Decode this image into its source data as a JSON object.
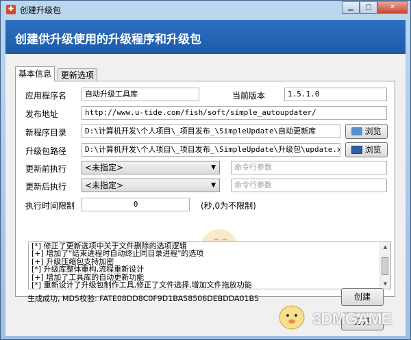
{
  "window": {
    "title": "创建升级包",
    "controls": [
      "▁",
      "▢",
      "✕"
    ]
  },
  "header": {
    "title": "创建供升级使用的升级程序和升级包"
  },
  "tabs": [
    {
      "label": "基本信息"
    },
    {
      "label": "更新选项"
    }
  ],
  "form": {
    "app_name_label": "应用程序名",
    "app_name_value": "自动升级工具库",
    "version_label": "当前版本",
    "version_value": "1.5.1.0",
    "publish_url_label": "发布地址",
    "publish_url_value": "http://www.u-tide.com/fish/soft/simple_autoupdater/",
    "new_dir_label": "新程序目录",
    "new_dir_value": "D:\\计算机开发\\个人项目\\_项目发布_\\SimpleUpdate\\自动更新库",
    "browse_label": "浏览",
    "package_path_label": "升级包路径",
    "package_path_value": "D:\\计算机开发\\个人项目\\_项目发布_\\SimpleUpdate\\升级包\\update.x",
    "browse2_label": "浏览",
    "pre_exec_label": "更新前执行",
    "pre_exec_select": "<未指定>",
    "pre_exec_args_placeholder": "命令行参数",
    "post_exec_label": "更新后执行",
    "post_exec_select": "<未指定>",
    "post_exec_args_placeholder": "命令行参数",
    "timeout_label": "执行时间限制",
    "timeout_value": "0",
    "timeout_hint": "(秒,0为不限制)"
  },
  "log_lines": [
    "[*] 修正了更新选项中关于文件删除的选项逻辑",
    "[+] 增加了\"结束进程时自动终止同目录进程\"的选项",
    "[+] 升级压缩包支持加密",
    "[*] 升级库整体重构,流程重新设计",
    "[+] 增加了工具库的自动更新功能",
    "[*] 重新设计了升级包制作工具,修正了文件选择,增加文件拖放功能"
  ],
  "status": {
    "text": "生成成功, MD5校验: FATE08DD8C0F9D1BA58506DEBDDA01B5"
  },
  "buttons": {
    "create_label": "创建",
    "open_label": "打开"
  },
  "watermark": {
    "text": "3DMGAME"
  },
  "colors": {
    "header_blue": "#2468bd",
    "frame_blue": "#a9c8e8"
  }
}
